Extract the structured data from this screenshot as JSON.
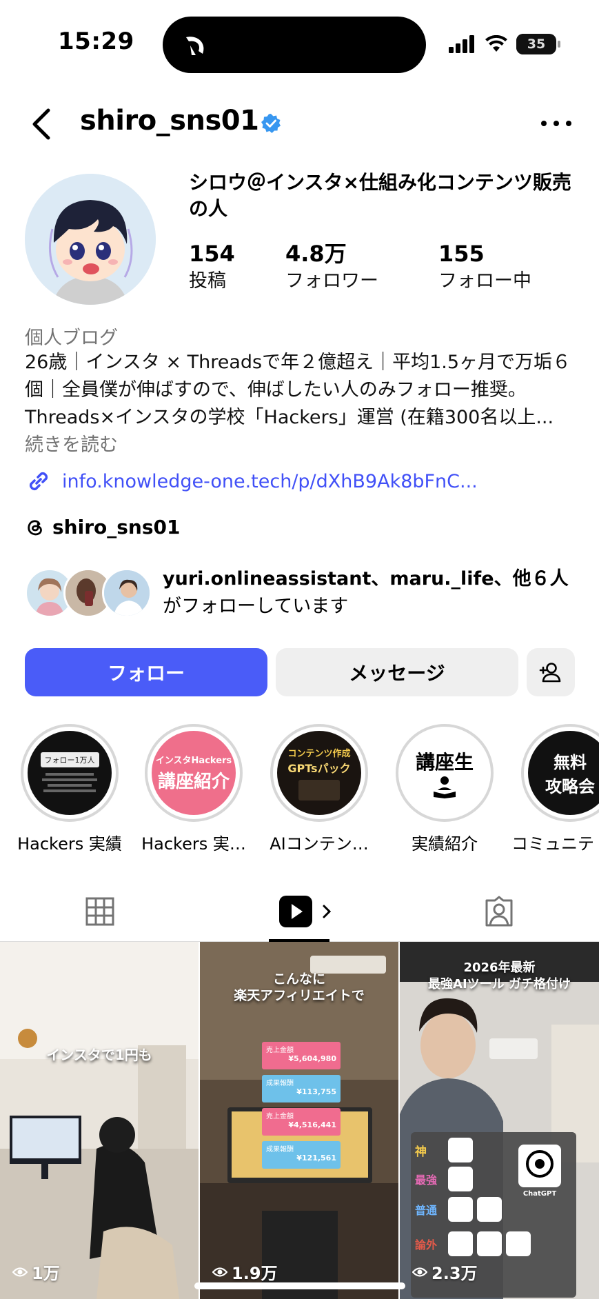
{
  "status_bar": {
    "time": "15:29",
    "battery": "35"
  },
  "header": {
    "username": "shiro_sns01"
  },
  "profile": {
    "display_name": "シロウ＠インスタ×仕組み化コンテンツ販売の人",
    "stats": [
      {
        "value": "154",
        "label": "投稿"
      },
      {
        "value": "4.8万",
        "label": "フォロワー"
      },
      {
        "value": "155",
        "label": "フォロー中"
      }
    ],
    "category": "個人ブログ",
    "bio": "26歳｜インスタ × Threadsで年２億超え｜平均1.5ヶ月で万垢６個｜全員僕が伸ばすので、伸ばしたい人のみフォロー推奨。Threads×インスタの学校「Hackers」運営 (在籍300名以上...",
    "bio_more": "続きを読む",
    "link": "info.knowledge-one.tech/p/dXhB9Ak8bFnC...",
    "threads_handle": "shiro_sns01",
    "followed_by_names": "yuri.onlineassistant、maru._life、他６人",
    "followed_by_suffix": "がフォローしています"
  },
  "actions": {
    "follow": "フォロー",
    "message": "メッセージ"
  },
  "highlights": [
    {
      "label": "Hackers 実績",
      "text": "フォロー1万人"
    },
    {
      "label": "Hackers 実…",
      "text_top": "インスタHackers",
      "text_main": "講座紹介"
    },
    {
      "label": "AIコンテン…",
      "text_top": "コンテンツ作成",
      "text_main": "GPTsパック"
    },
    {
      "label": "実績紹介",
      "text_main": "講座生"
    },
    {
      "label": "コミュニテ",
      "text_top": "無料",
      "text_main": "攻略会"
    }
  ],
  "grid": [
    {
      "caption": "インスタで1円も",
      "views": "1万"
    },
    {
      "caption_line1": "こんなに",
      "caption_line2": "楽天アフィリエイトで",
      "views": "1.9万",
      "cards": [
        {
          "label": "売上金額",
          "amount": "¥5,604,980"
        },
        {
          "label": "成果報酬",
          "amount": "¥113,755"
        },
        {
          "label": "売上金額",
          "amount": "¥4,516,441"
        },
        {
          "label": "成果報酬",
          "amount": "¥121,561"
        }
      ]
    },
    {
      "caption_line1": "2026年最新",
      "caption_line2": "最強AIツール ガチ格付け",
      "views": "2.3万",
      "tiers": [
        "神",
        "最強",
        "普通",
        "論外"
      ],
      "tool": "ChatGPT"
    }
  ],
  "colors": {
    "follow_button": "#4a5cf8",
    "link": "#4150f7",
    "verified": "#3897f0"
  }
}
